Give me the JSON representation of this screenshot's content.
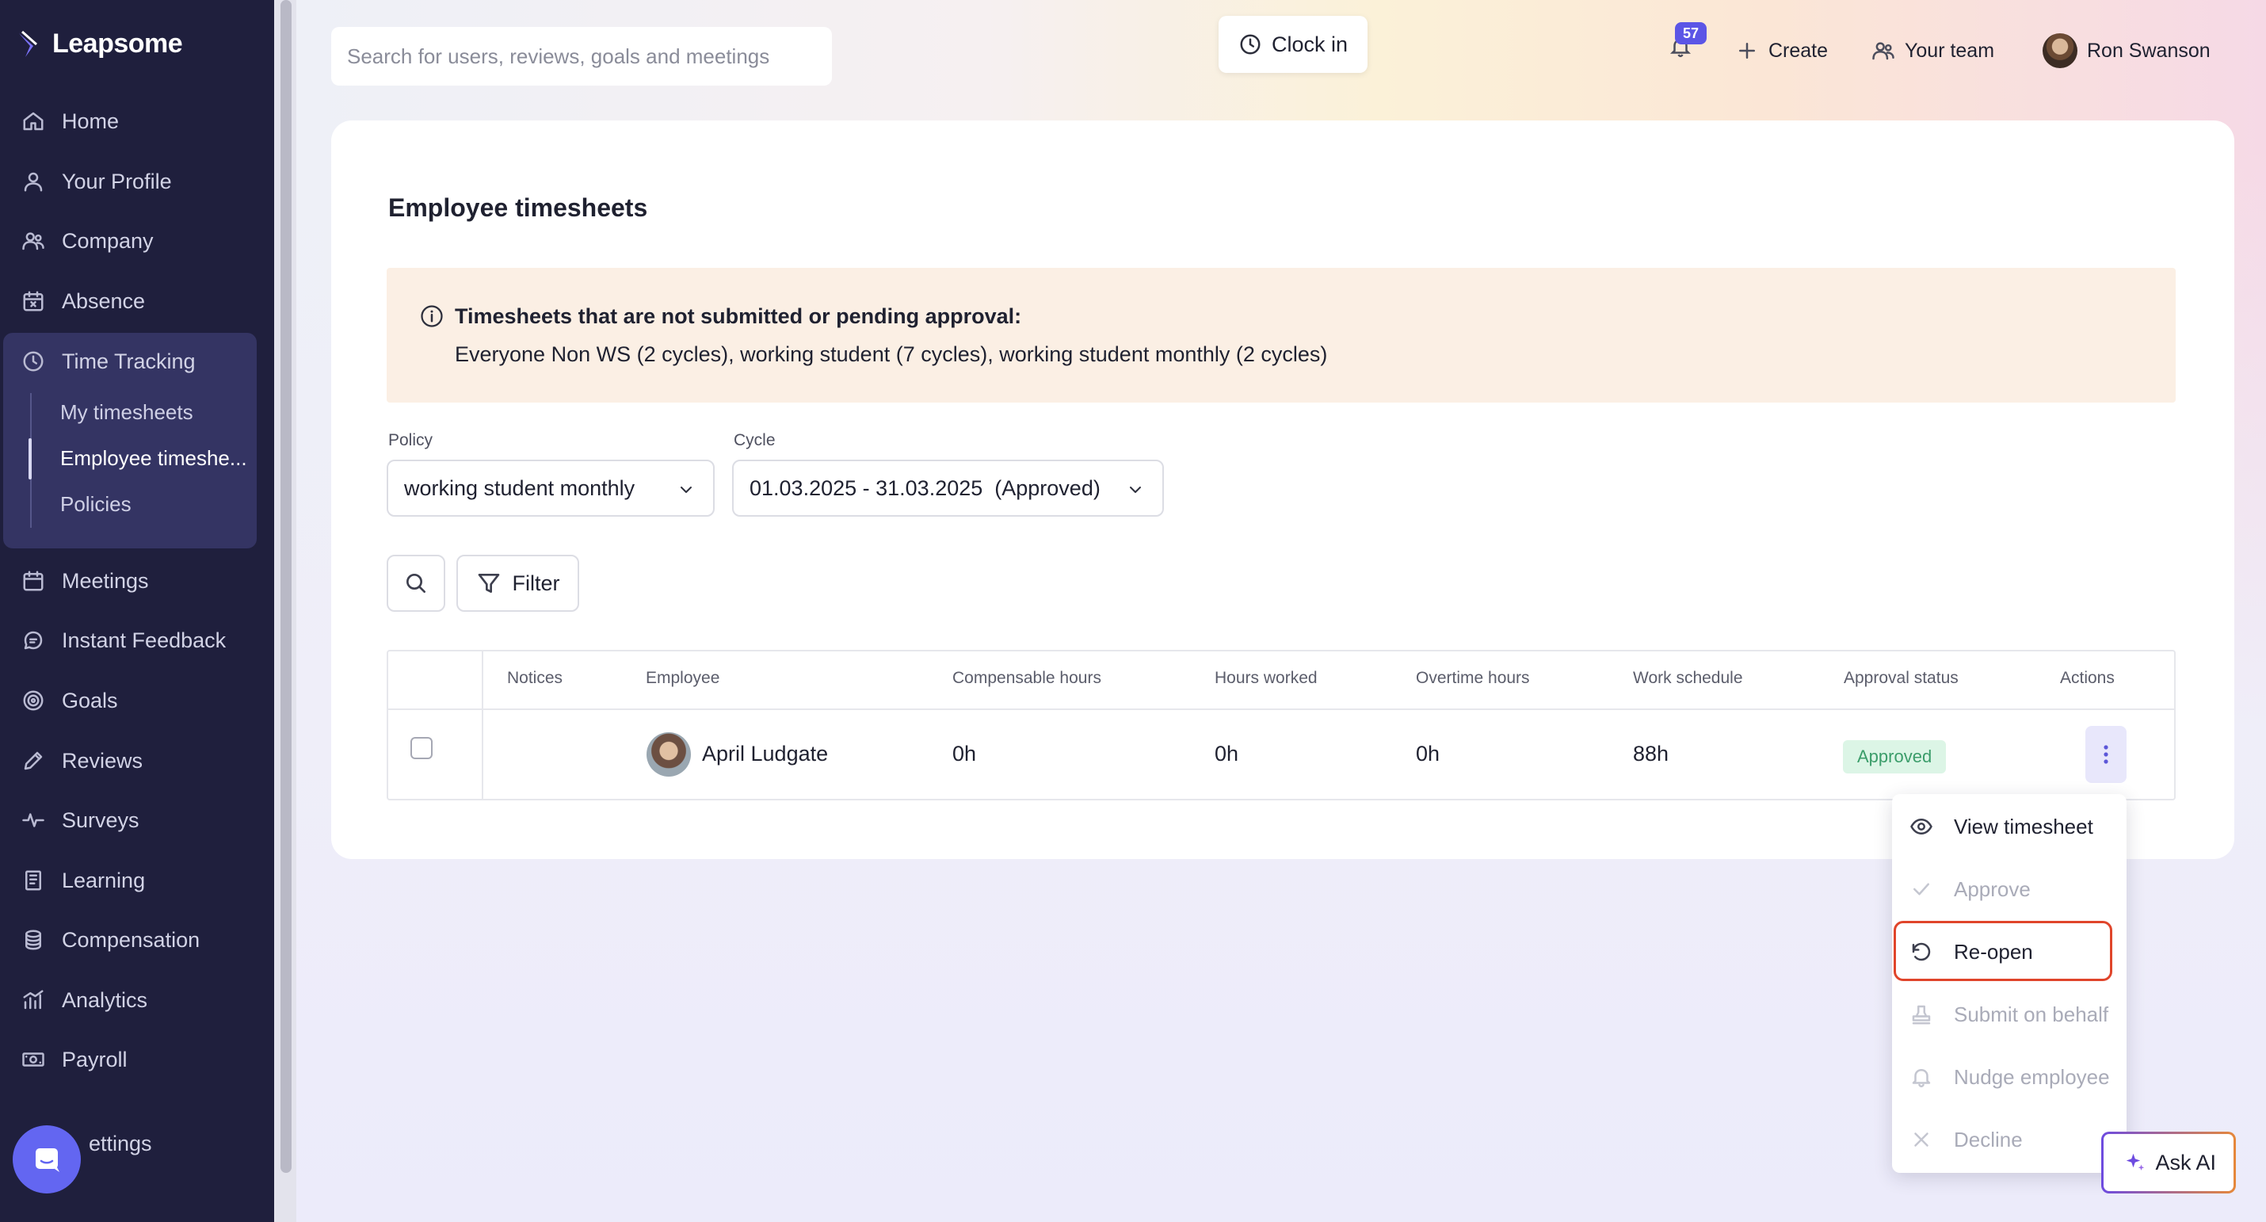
{
  "app": {
    "brand": "Leapsome"
  },
  "sidebar": {
    "items": [
      {
        "label": "Home",
        "icon": "home-icon"
      },
      {
        "label": "Your Profile",
        "icon": "user-icon"
      },
      {
        "label": "Company",
        "icon": "users-icon"
      },
      {
        "label": "Absence",
        "icon": "calendar-x-icon"
      },
      {
        "label": "Time Tracking",
        "icon": "clock-icon"
      },
      {
        "label": "Meetings",
        "icon": "calendar-icon"
      },
      {
        "label": "Instant Feedback",
        "icon": "chat-icon"
      },
      {
        "label": "Goals",
        "icon": "target-icon"
      },
      {
        "label": "Reviews",
        "icon": "pen-icon"
      },
      {
        "label": "Surveys",
        "icon": "pulse-icon"
      },
      {
        "label": "Learning",
        "icon": "book-icon"
      },
      {
        "label": "Compensation",
        "icon": "coins-icon"
      },
      {
        "label": "Analytics",
        "icon": "chart-icon"
      },
      {
        "label": "Payroll",
        "icon": "money-icon"
      },
      {
        "label": "ettings",
        "icon": "gear-icon"
      }
    ],
    "time_tracking_sub": [
      {
        "label": "My timesheets"
      },
      {
        "label": "Employee timeshe..."
      },
      {
        "label": "Policies"
      }
    ]
  },
  "topbar": {
    "search_placeholder": "Search for users, reviews, goals and meetings",
    "clock_in": "Clock in",
    "notifications_count": "57",
    "create": "Create",
    "your_team": "Your team",
    "user_name": "Ron Swanson"
  },
  "page": {
    "title": "Employee timesheets",
    "notice_title": "Timesheets that are not submitted or pending approval:",
    "notice_body": "Everyone Non WS (2 cycles), working student (7 cycles), working student monthly (2 cycles)",
    "policy_label": "Policy",
    "policy_value": "working student monthly",
    "cycle_label": "Cycle",
    "cycle_value": "01.03.2025 - 31.03.2025  (Approved)",
    "filter_label": "Filter"
  },
  "table": {
    "headers": [
      "Notices",
      "Employee",
      "Compensable hours",
      "Hours worked",
      "Overtime hours",
      "Work schedule",
      "Approval status",
      "Actions"
    ],
    "rows": [
      {
        "employee": "April Ludgate",
        "compensable": "0h",
        "worked": "0h",
        "overtime": "0h",
        "schedule": "88h",
        "status": "Approved"
      }
    ]
  },
  "menu": {
    "items": [
      {
        "label": "View timesheet",
        "enabled": true,
        "icon": "eye-icon"
      },
      {
        "label": "Approve",
        "enabled": false,
        "icon": "check-icon"
      },
      {
        "label": "Re-open",
        "enabled": true,
        "icon": "reopen-icon"
      },
      {
        "label": "Submit on behalf",
        "enabled": false,
        "icon": "stamp-icon"
      },
      {
        "label": "Nudge employee",
        "enabled": false,
        "icon": "bell-icon"
      },
      {
        "label": "Decline",
        "enabled": false,
        "icon": "x-icon"
      }
    ]
  },
  "ask_ai": "Ask AI",
  "colors": {
    "sidebar_bg": "#1f1f3d",
    "accent": "#5b55e6",
    "highlight": "#e0452b",
    "approved": "#3b9d6a"
  }
}
